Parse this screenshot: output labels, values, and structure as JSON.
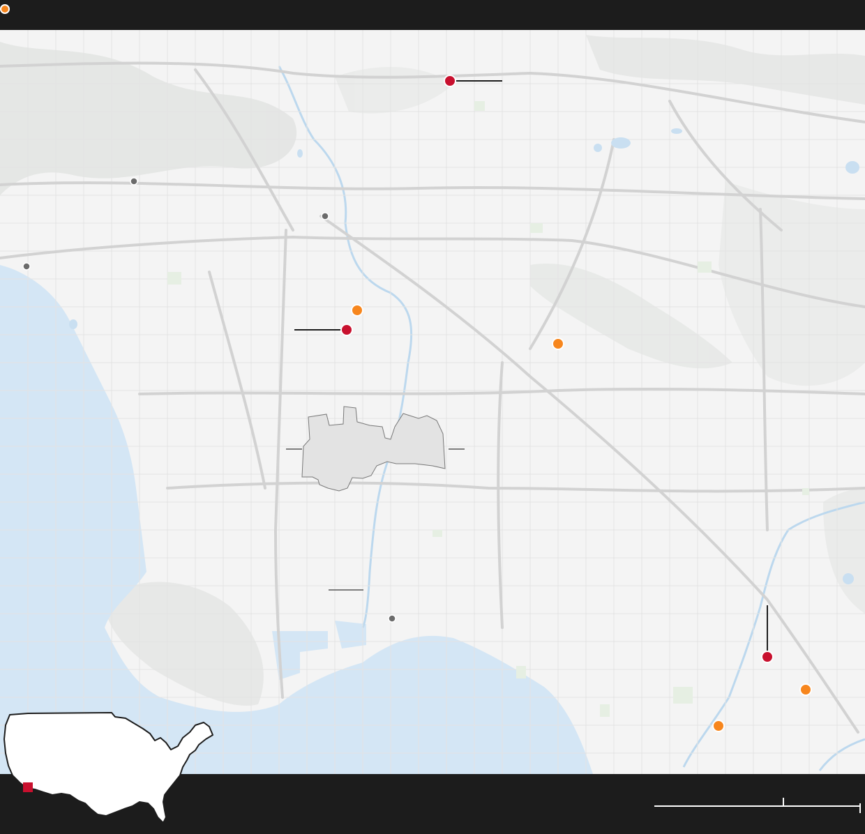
{
  "legend": {
    "label": "",
    "color": "#f7861d"
  },
  "colors": {
    "land": "#f4f4f4",
    "water": "#d4e6f5",
    "road": "#d9d9d9",
    "major_road": "#cfcfcf",
    "area_fill": "#e3e3e3",
    "area_stroke": "#777777",
    "red_marker": "#c8102e",
    "orange_marker": "#f7861d",
    "gray_marker": "#6b6b6b",
    "bar": "#1c1c1c",
    "inset_highlight": "#c8102e"
  },
  "scale_bar": {
    "label": ""
  },
  "inset_map": {
    "label": ""
  }
}
